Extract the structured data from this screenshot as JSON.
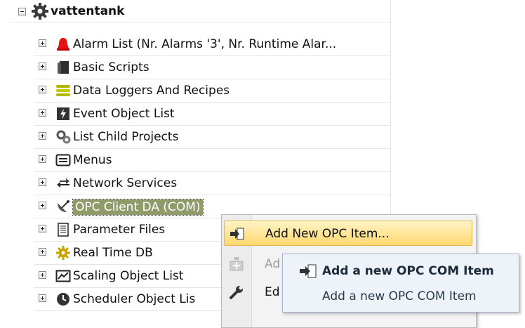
{
  "tree": {
    "root": {
      "label": "vattentank",
      "icon": "gear-cog-icon"
    },
    "items": [
      {
        "label": "Alarm List (Nr. Alarms '3', Nr. Runtime Alar...",
        "icon": "alarm-bell-icon"
      },
      {
        "label": "Basic Scripts",
        "icon": "script-icon"
      },
      {
        "label": "Data Loggers And Recipes",
        "icon": "database-icon"
      },
      {
        "label": "Event Object List",
        "icon": "event-icon"
      },
      {
        "label": "List Child Projects",
        "icon": "gears-icon"
      },
      {
        "label": "Menus",
        "icon": "menu-window-icon"
      },
      {
        "label": "Network Services",
        "icon": "network-arrows-icon"
      },
      {
        "label": "OPC Client DA (COM)",
        "icon": "satellite-dish-icon",
        "selected": true
      },
      {
        "label": "Parameter Files",
        "icon": "document-icon"
      },
      {
        "label": "Real Time DB",
        "icon": "gear-cog-icon"
      },
      {
        "label": "Scaling Object List",
        "icon": "scaling-icon"
      },
      {
        "label": "Scheduler Object Lis",
        "icon": "clock-icon"
      }
    ]
  },
  "context_menu": {
    "items": [
      {
        "label": "Add New OPC Item...",
        "icon": "add-item-arrow-icon",
        "highlighted": true
      },
      {
        "label": "Ad",
        "icon": "add-disabled-icon",
        "disabled": true
      },
      {
        "label": "Ed",
        "icon": "wrench-icon"
      }
    ]
  },
  "submenu": {
    "title": "Add a new OPC COM Item",
    "description": "Add a new OPC COM Item",
    "icon": "add-item-arrow-icon"
  }
}
